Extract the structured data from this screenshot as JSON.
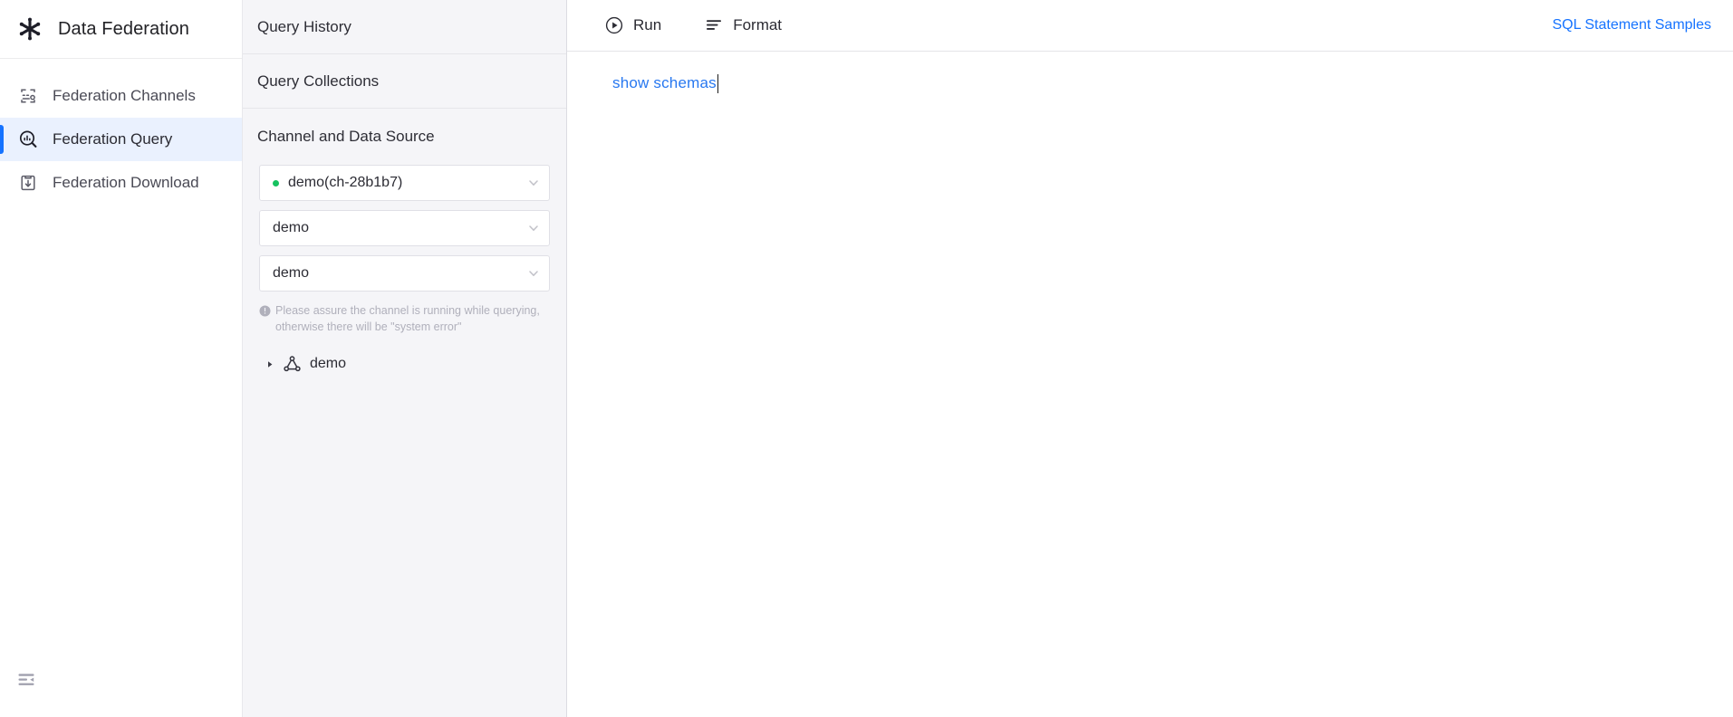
{
  "nav": {
    "brand": {
      "title": "Data Federation",
      "logo_icon": "snowflake-logo-icon"
    },
    "items": [
      {
        "label": "Federation Channels",
        "icon": "channels-icon",
        "active": false
      },
      {
        "label": "Federation Query",
        "icon": "query-search-icon",
        "active": true
      },
      {
        "label": "Federation Download",
        "icon": "download-box-icon",
        "active": false
      }
    ],
    "collapse_icon": "menu-fold-icon",
    "active_accent_color": "#1673ff",
    "active_bg_color": "#eaf1fe"
  },
  "panel": {
    "query_history_label": "Query History",
    "query_collections_label": "Query Collections",
    "section_title": "Channel and Data Source",
    "selects": [
      {
        "value": "demo(ch-28b1b7)",
        "status_dot": true,
        "status_color": "#16c260",
        "chevron_icon": "chevron-down-icon"
      },
      {
        "value": "demo",
        "status_dot": false,
        "chevron_icon": "chevron-down-icon"
      },
      {
        "value": "demo",
        "status_dot": false,
        "chevron_icon": "chevron-down-icon"
      }
    ],
    "hint": {
      "icon": "info-circle-icon",
      "text": "Please assure the channel is running while querying, otherwise there will be \"system error\""
    },
    "tree": [
      {
        "label": "demo",
        "icon": "schema-node-icon",
        "caret_icon": "caret-right-icon",
        "expanded": false
      }
    ]
  },
  "toolbar": {
    "run_label": "Run",
    "run_icon": "play-circle-icon",
    "format_label": "Format",
    "format_icon": "format-lines-icon",
    "samples_link_label": "SQL Statement Samples",
    "link_color": "#1673ff"
  },
  "editor": {
    "sql_text": "show schemas",
    "sql_color": "#2878f0",
    "cursor_visible": true
  }
}
